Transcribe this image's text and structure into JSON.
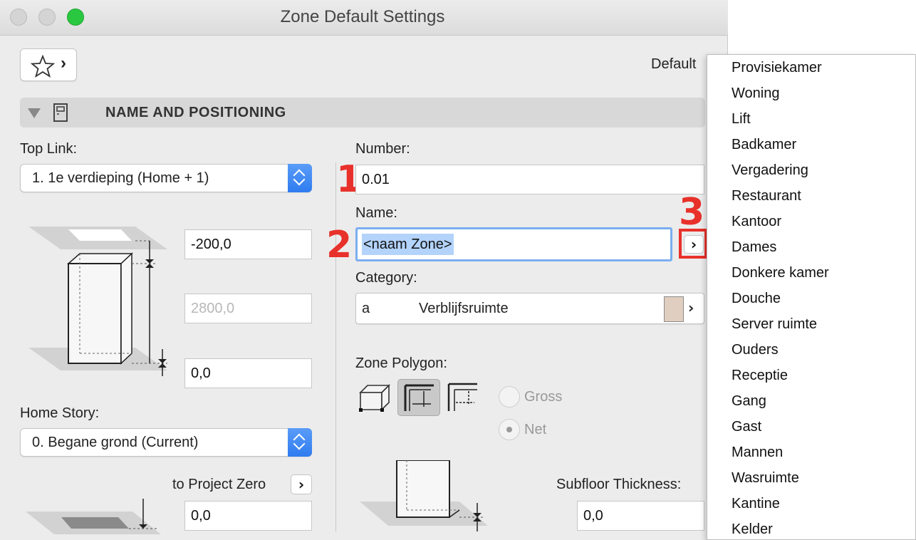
{
  "window": {
    "title": "Zone Default Settings"
  },
  "toolbar": {
    "favorites_chevron": "›",
    "default_label": "Default"
  },
  "section": {
    "title": "NAME AND POSITIONING"
  },
  "left": {
    "top_link_label": "Top Link:",
    "top_link_value": "1. 1e verdieping (Home + 1)",
    "top_offset": "-200,0",
    "height": "2800,0",
    "bottom_offset": "0,0",
    "home_story_label": "Home Story:",
    "home_story_value": "0. Begane grond (Current)",
    "to_project_zero_label": "to Project Zero",
    "to_project_zero_chevron": "›",
    "project_zero_value": "0,0"
  },
  "right": {
    "number_label": "Number:",
    "number_value": "0.01",
    "name_label": "Name:",
    "name_value": "<naam Zone>",
    "name_chevron": "›",
    "category_label": "Category:",
    "category_code": "a",
    "category_name": "Verblijfsruimte",
    "category_chevron": "›",
    "category_color": "#e0cfc0",
    "zone_polygon_label": "Zone Polygon:",
    "gross_label": "Gross",
    "net_label": "Net",
    "net_selected": true,
    "subfloor_label": "Subfloor Thickness:",
    "subfloor_value": "0,0"
  },
  "annotations": {
    "one": "1",
    "two": "2",
    "three": "3",
    "color": "#e8312a"
  },
  "dropdown": {
    "items": [
      "Provisiekamer",
      "Woning",
      "Lift",
      "Badkamer",
      "Vergadering",
      "Restaurant",
      "Kantoor",
      "Dames",
      "Donkere kamer",
      "Douche",
      "Server ruimte",
      "Ouders",
      "Receptie",
      "Gang",
      "Gast",
      "Mannen",
      "Wasruimte",
      "Kantine",
      "Kelder"
    ]
  }
}
